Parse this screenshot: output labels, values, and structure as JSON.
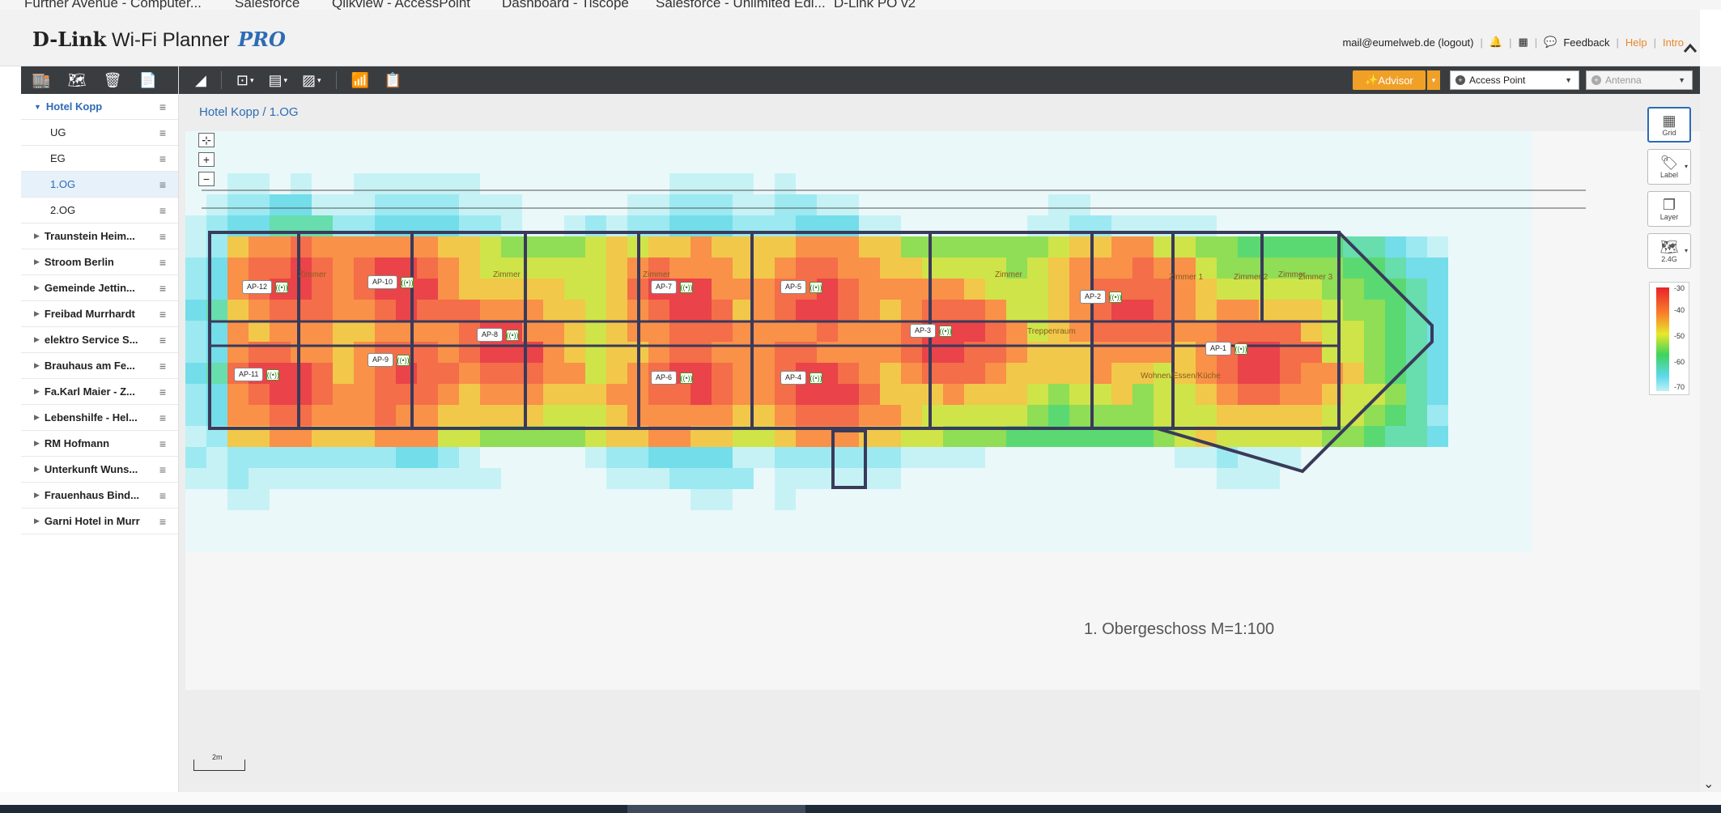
{
  "bookmarks": [
    "Further Avenue - Computer...",
    "Salesforce",
    "Qlikview - AccessPoint",
    "Dashboard - Tiscope",
    "Salesforce - Unlimited Edi...",
    "D-Link PO v2"
  ],
  "app": {
    "logo_brand": "D-Link",
    "logo_product": "Wi-Fi Planner",
    "logo_pro": "PRO"
  },
  "top": {
    "user": "mail@eumelweb.de (logout)",
    "feedback": "Feedback",
    "help": "Help",
    "intro": "Intro"
  },
  "sidebar": {
    "root": "Hotel Kopp",
    "floors": [
      "UG",
      "EG",
      "1.OG",
      "2.OG"
    ],
    "active_floor": "1.OG",
    "sites": [
      "Traunstein Heim...",
      "Stroom Berlin",
      "Gemeinde Jettin...",
      "Freibad Murrhardt",
      "elektro Service S...",
      "Brauhaus am Fe...",
      "Fa.Karl Maier - Z...",
      "Lebenshilfe - Hel...",
      "RM Hofmann",
      "Unterkunft Wuns...",
      "Frauenhaus Bind...",
      "Garni Hotel in Murr"
    ]
  },
  "toolbar": {
    "advisor": "Advisor",
    "device_select": "Access Point",
    "antenna_select": "Antenna"
  },
  "breadcrumb": "Hotel Kopp / 1.OG",
  "right_tools": {
    "grid": "Grid",
    "label": "Label",
    "layer": "Layer",
    "band": "2.4G"
  },
  "legend": {
    "ticks": [
      "-30",
      "-40",
      "-50",
      "-60",
      "-70"
    ]
  },
  "scale_label": "2m",
  "plan_title": "1. Obergeschoss M=1:100",
  "access_points": [
    "AP-12",
    "AP-10",
    "AP-7",
    "AP-5",
    "AP-2",
    "AP-8",
    "AP-3",
    "AP-1",
    "AP-11",
    "AP-9",
    "AP-6",
    "AP-4"
  ],
  "rooms": [
    "Zimmer",
    "Zimmer",
    "Zimmer",
    "Zimmer",
    "Zimmer",
    "Zimmer 1",
    "Zimmer 2",
    "Zimmer 3",
    "Wohnen/Essen/Küche",
    "Treppenraum"
  ],
  "colors": {
    "toolbar": "#3a3d40",
    "accent_blue": "#2d6bb5",
    "advisor_orange": "#f0a027",
    "heat_red": "#e8232a",
    "heat_green": "#3ed35c",
    "heat_cyan": "#5cd8e8"
  }
}
